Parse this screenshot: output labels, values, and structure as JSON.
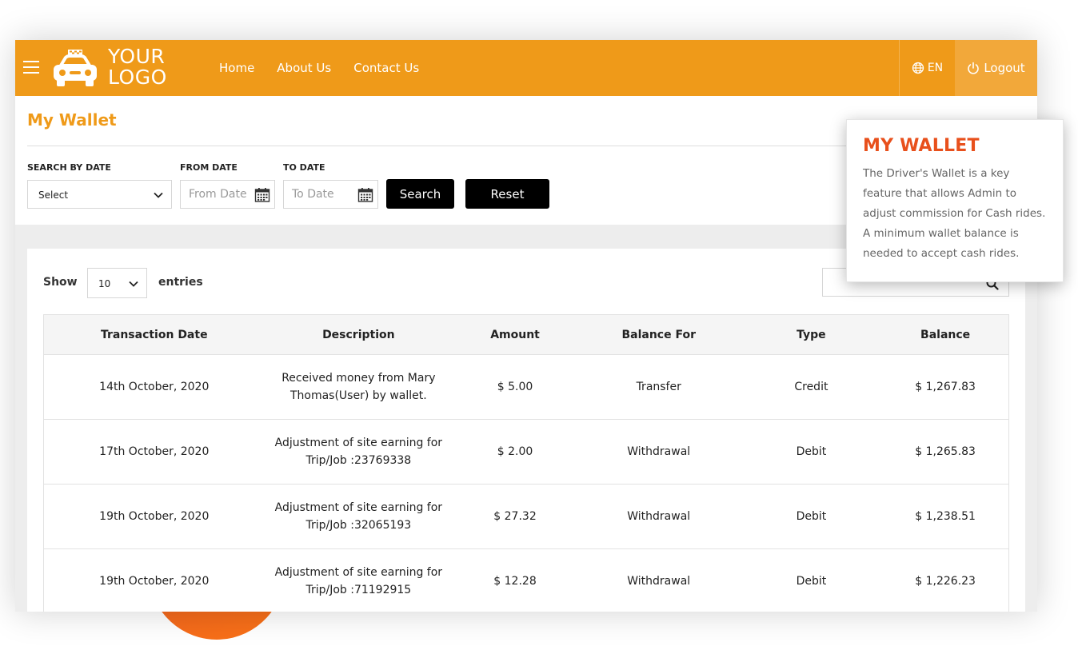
{
  "navbar": {
    "logo_line1": "YOUR",
    "logo_line2": "LOGO",
    "links": [
      "Home",
      "About Us",
      "Contact Us"
    ],
    "language": "EN",
    "logout_label": "Logout",
    "color": "#ef9a19"
  },
  "page": {
    "title": "My Wallet"
  },
  "filters": {
    "search_by_date_label": "SEARCH BY DATE",
    "search_by_date_value": "Select",
    "from_date_label": "FROM DATE",
    "from_date_placeholder": "From Date",
    "to_date_label": "TO DATE",
    "to_date_placeholder": "To Date",
    "search_button": "Search",
    "reset_button": "Reset"
  },
  "table_controls": {
    "show_label": "Show",
    "entries_value": "10",
    "entries_label": "entries"
  },
  "table": {
    "headers": [
      "Transaction Date",
      "Description",
      "Amount",
      "Balance For",
      "Type",
      "Balance"
    ],
    "rows": [
      {
        "date": "14th October, 2020",
        "description": "Received money from Mary Thomas(User) by wallet.",
        "amount": "$ 5.00",
        "balance_for": "Transfer",
        "type": "Credit",
        "balance": "$ 1,267.83"
      },
      {
        "date": "17th October, 2020",
        "description": "Adjustment of site earning for Trip/Job :23769338",
        "amount": "$ 2.00",
        "balance_for": "Withdrawal",
        "type": "Debit",
        "balance": "$ 1,265.83"
      },
      {
        "date": "19th October, 2020",
        "description": "Adjustment of site earning for Trip/Job :32065193",
        "amount": "$ 27.32",
        "balance_for": "Withdrawal",
        "type": "Debit",
        "balance": "$ 1,238.51"
      },
      {
        "date": "19th October, 2020",
        "description": "Adjustment of site earning for Trip/Job :71192915",
        "amount": "$ 12.28",
        "balance_for": "Withdrawal",
        "type": "Debit",
        "balance": "$ 1,226.23"
      }
    ]
  },
  "tooltip": {
    "title": "MY WALLET",
    "text": "The Driver's Wallet is a key feature that allows Admin to adjust commission for Cash rides. A minimum wallet balance is needed to accept cash rides.",
    "title_color": "#e8501c"
  },
  "icons": [
    "hamburger-icon",
    "car-logo-icon",
    "globe-icon",
    "power-icon",
    "chevron-down-icon",
    "calendar-icon",
    "search-icon"
  ]
}
